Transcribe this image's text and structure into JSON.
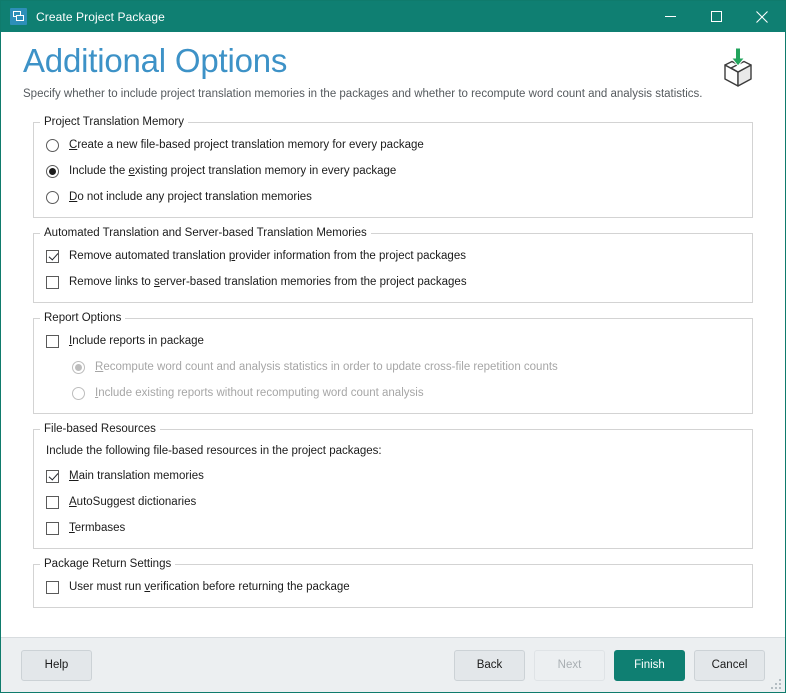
{
  "window": {
    "title": "Create Project Package",
    "icon": "app-window-icon",
    "minimize_label": "Minimize",
    "maximize_label": "Maximize",
    "close_label": "Close",
    "titlebar_color": "#0f7f72"
  },
  "header": {
    "title": "Additional Options",
    "subtitle": "Specify whether to include project translation memories in the packages and whether to recompute word count and analysis statistics.",
    "icon": "package-download-icon",
    "title_color": "#3d92c7"
  },
  "groups": {
    "translation_memory": {
      "legend": "Project Translation Memory",
      "options": [
        {
          "pre": "",
          "mn": "C",
          "post": "reate a new file-based project translation memory for every package",
          "checked": false
        },
        {
          "pre": "Include the ",
          "mn": "e",
          "post": "xisting project translation memory in every package",
          "checked": true
        },
        {
          "pre": "",
          "mn": "D",
          "post": "o not include any project translation memories",
          "checked": false
        }
      ]
    },
    "automated_translation": {
      "legend": "Automated Translation and Server-based Translation Memories",
      "options": [
        {
          "pre": "Remove automated translation ",
          "mn": "p",
          "post": "rovider information from the project packages",
          "checked": true
        },
        {
          "pre": "Remove links to ",
          "mn": "s",
          "post": "erver-based translation memories from the project packages",
          "checked": false
        }
      ]
    },
    "report_options": {
      "legend": "Report Options",
      "checkbox": {
        "pre": "",
        "mn": "I",
        "post": "nclude reports in package",
        "checked": false
      },
      "radios": [
        {
          "pre": "",
          "mn": "R",
          "post": "ecompute word count and analysis statistics in order to update cross-file repetition counts",
          "checked": true,
          "disabled": true
        },
        {
          "pre": "",
          "mn": "I",
          "post": "nclude existing reports without recomputing word count analysis",
          "checked": false,
          "disabled": true
        }
      ]
    },
    "file_resources": {
      "legend": "File-based Resources",
      "intro": "Include the following file-based resources in the project packages:",
      "options": [
        {
          "pre": "",
          "mn": "M",
          "post": "ain translation memories",
          "checked": true
        },
        {
          "pre": "",
          "mn": "A",
          "post": "utoSuggest dictionaries",
          "checked": false
        },
        {
          "pre": "",
          "mn": "T",
          "post": "ermbases",
          "checked": false
        }
      ]
    },
    "package_return": {
      "legend": "Package Return Settings",
      "options": [
        {
          "pre": "User must run ",
          "mn": "v",
          "post": "erification before returning the package",
          "checked": false
        }
      ]
    }
  },
  "footer": {
    "help": "Help",
    "back": "Back",
    "next": "Next",
    "finish": "Finish",
    "cancel": "Cancel",
    "next_disabled": true,
    "primary_color": "#0f7f72"
  }
}
